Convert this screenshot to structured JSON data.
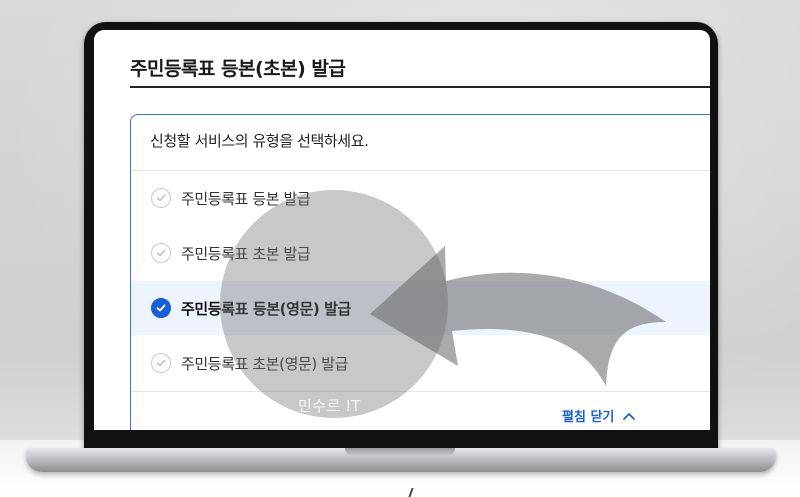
{
  "page": {
    "title": "주민등록표 등본(초본) 발급",
    "instruction": "신청할 서비스의 유형을 선택하세요."
  },
  "options": [
    {
      "label": "주민등록표 등본 발급",
      "selected": false
    },
    {
      "label": "주민등록표 초본 발급",
      "selected": false
    },
    {
      "label": "주민등록표 등본(영문) 발급",
      "selected": true
    },
    {
      "label": "주민등록표 초본(영문) 발급",
      "selected": false
    }
  ],
  "toggle": {
    "label": "펼침 닫기",
    "icon": "chevron-up-icon"
  },
  "watermark": "민수르 IT",
  "colors": {
    "accent": "#1a5fd8",
    "selected_bg": "#eef4fd",
    "border": "#3b74d8"
  }
}
